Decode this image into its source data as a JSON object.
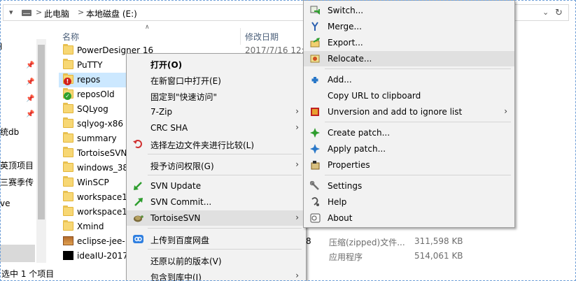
{
  "address_bar": {
    "segments": [
      "此电脑",
      "本地磁盘 (E:)"
    ],
    "separator": ">"
  },
  "nav": {
    "items": [
      "统db",
      "英顶项目",
      "三赛季传",
      "ve"
    ]
  },
  "columns": {
    "name": "名称",
    "modified": "修改日期"
  },
  "files": [
    {
      "name": "PowerDesigner 16",
      "type": "folder",
      "modified": "2017/7/16 12:0"
    },
    {
      "name": "PuTTY",
      "type": "folder"
    },
    {
      "name": "repos",
      "type": "svn-conflict",
      "selected": true
    },
    {
      "name": "reposOld",
      "type": "svn-ok"
    },
    {
      "name": "SQLyog",
      "type": "folder"
    },
    {
      "name": "sqlyog-x86",
      "type": "folder"
    },
    {
      "name": "summary",
      "type": "folder"
    },
    {
      "name": "TortoiseSVN",
      "type": "folder"
    },
    {
      "name": "windows_38",
      "type": "folder"
    },
    {
      "name": "WinSCP",
      "type": "folder"
    },
    {
      "name": "workspace1",
      "type": "folder"
    },
    {
      "name": "workspace1",
      "type": "folder"
    },
    {
      "name": "Xmind",
      "type": "folder"
    },
    {
      "name": "eclipse-jee-",
      "type": "archive",
      "kind": "压缩(zipped)文件...",
      "size": "311,598 KB",
      "extra": "8"
    },
    {
      "name": "ideaIU-2017",
      "type": "app",
      "kind": "应用程序",
      "size": "514,061 KB"
    }
  ],
  "status": {
    "text": "选中 1 个项目"
  },
  "context_menu": {
    "items": [
      {
        "label": "打开(O)",
        "bold": true
      },
      {
        "label": "在新窗口中打开(E)"
      },
      {
        "label": "固定到\"快速访问\""
      },
      {
        "label": "7-Zip",
        "submenu": true
      },
      {
        "label": "CRC SHA",
        "submenu": true
      },
      {
        "label": "选择左边文件夹进行比较(L)",
        "icon": "compare-icon"
      },
      {
        "label": "授予访问权限(G)",
        "submenu": true
      },
      {
        "label": "SVN Update",
        "icon": "svn-update-icon"
      },
      {
        "label": "SVN Commit...",
        "icon": "svn-commit-icon"
      },
      {
        "label": "TortoiseSVN",
        "icon": "tortoise-icon",
        "submenu": true,
        "highlighted": true
      },
      {
        "label": "上传到百度网盘",
        "icon": "baidu-cloud-icon"
      },
      {
        "label": "还原以前的版本(V)"
      },
      {
        "label": "包含到库中(I)",
        "submenu": true
      }
    ]
  },
  "svn_submenu": {
    "items": [
      {
        "label": "Switch...",
        "icon": "switch-icon"
      },
      {
        "label": "Merge...",
        "icon": "merge-icon"
      },
      {
        "label": "Export...",
        "icon": "export-icon"
      },
      {
        "label": "Relocate...",
        "icon": "relocate-icon",
        "highlighted": true
      },
      {
        "label": "Add...",
        "icon": "add-icon"
      },
      {
        "label": "Copy URL to clipboard"
      },
      {
        "label": "Unversion and add to ignore list",
        "icon": "ignore-icon",
        "submenu": true
      },
      {
        "label": "Create patch...",
        "icon": "create-patch-icon"
      },
      {
        "label": "Apply patch...",
        "icon": "apply-patch-icon"
      },
      {
        "label": "Properties",
        "icon": "properties-icon"
      },
      {
        "label": "Settings",
        "icon": "settings-icon"
      },
      {
        "label": "Help",
        "icon": "help-icon"
      },
      {
        "label": "About",
        "icon": "about-icon"
      }
    ]
  },
  "colors": {
    "selection": "#cce8ff",
    "menu_bg": "#f2f2f2",
    "menu_highlight": "#e0e0e0",
    "header_text": "#4c607a"
  }
}
